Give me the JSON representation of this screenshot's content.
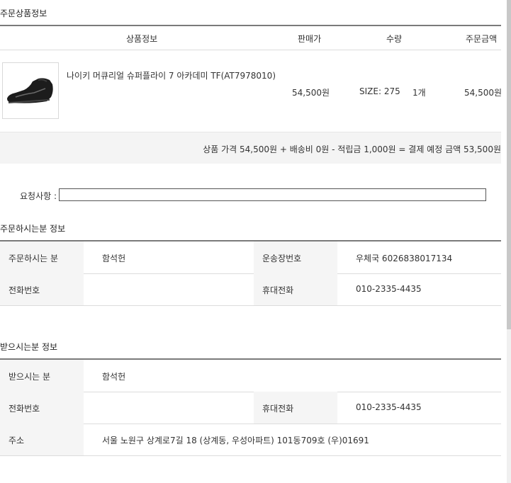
{
  "order_items": {
    "title": "주문상품정보",
    "headers": {
      "product_info": "상품정보",
      "price": "판매가",
      "quantity": "수량",
      "order_amount": "주문금액"
    },
    "item": {
      "name": "나이키 머큐리얼 슈퍼플라이 7 아카데미 TF(AT7978010)",
      "price": "54,500원",
      "size": "SIZE: 275",
      "quantity": "1개",
      "amount": "54,500원",
      "image_icon": "soccer-shoe-icon"
    },
    "summary": "상품 가격 54,500원 + 배송비 0원 - 적립금 1,000원 = 결제 예정 금액 53,500원"
  },
  "request": {
    "label": "요청사항 :",
    "value": ""
  },
  "orderer": {
    "title": "주문하시는분 정보",
    "name_label": "주문하시는 분",
    "name": "함석헌",
    "tracking_label": "운송장번호",
    "tracking": "우체국 6026838017134",
    "phone_label": "전화번호",
    "phone": "",
    "mobile_label": "휴대전화",
    "mobile": "010-2335-4435"
  },
  "recipient": {
    "title": "받으시는분 정보",
    "name_label": "받으시는 분",
    "name": "함석헌",
    "phone_label": "전화번호",
    "phone": "",
    "mobile_label": "휴대전화",
    "mobile": "010-2335-4435",
    "address_label": "주소",
    "address": "서울 노원구 상계로7길 18 (상계동, 우성아파트) 101동709호 (우)01691"
  },
  "colors": {
    "header_rule": "#7a7a7a",
    "label_bg": "#f5f5f5",
    "summary_bg": "#f4f4f4"
  }
}
